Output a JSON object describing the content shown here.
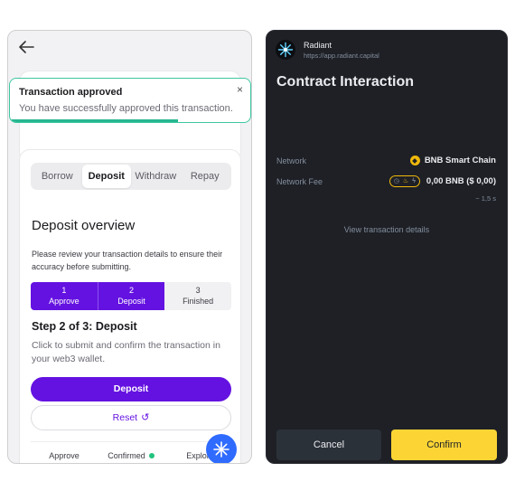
{
  "left": {
    "toast": {
      "title": "Transaction approved",
      "message": "You have successfully approved this transaction.",
      "close_symbol": "×",
      "progress_fraction": 0.7
    },
    "tabs": [
      {
        "label": "Borrow",
        "active": false
      },
      {
        "label": "Deposit",
        "active": true
      },
      {
        "label": "Withdraw",
        "active": false
      },
      {
        "label": "Repay",
        "active": false
      }
    ],
    "overview": {
      "title": "Deposit overview",
      "description": "Please review your transaction details to ensure their accuracy before submitting."
    },
    "steps": [
      {
        "number": "1",
        "label": "Approve",
        "done": true
      },
      {
        "number": "2",
        "label": "Deposit",
        "done": true
      },
      {
        "number": "3",
        "label": "Finished",
        "done": false
      }
    ],
    "step_title": "Step 2 of 3: Deposit",
    "step_desc": "Click to submit and confirm the transaction in your web3 wallet.",
    "deposit_button": "Deposit",
    "reset_button": "Reset",
    "reset_icon": "↺",
    "footer": {
      "approve": "Approve",
      "confirmed": "Confirmed",
      "explorer": "Explor"
    },
    "colors": {
      "accent": "#6412e1",
      "toast_border": "#3ec7a2",
      "status_green": "#21c27d",
      "fab": "#2f6bff"
    }
  },
  "right": {
    "app": {
      "name": "Radiant",
      "url": "https://app.radiant.capital"
    },
    "title": "Contract Interaction",
    "network": {
      "label": "Network",
      "value": "BNB Smart Chain"
    },
    "fee": {
      "label": "Network Fee",
      "value": "0,00 BNB ($ 0,00)",
      "eta": "~ 1,5 s"
    },
    "view_details": "View transaction details",
    "cancel_button": "Cancel",
    "confirm_button": "Confirm",
    "colors": {
      "background": "#1e2026",
      "confirm": "#fcd535",
      "cancel": "#2b3139"
    }
  }
}
